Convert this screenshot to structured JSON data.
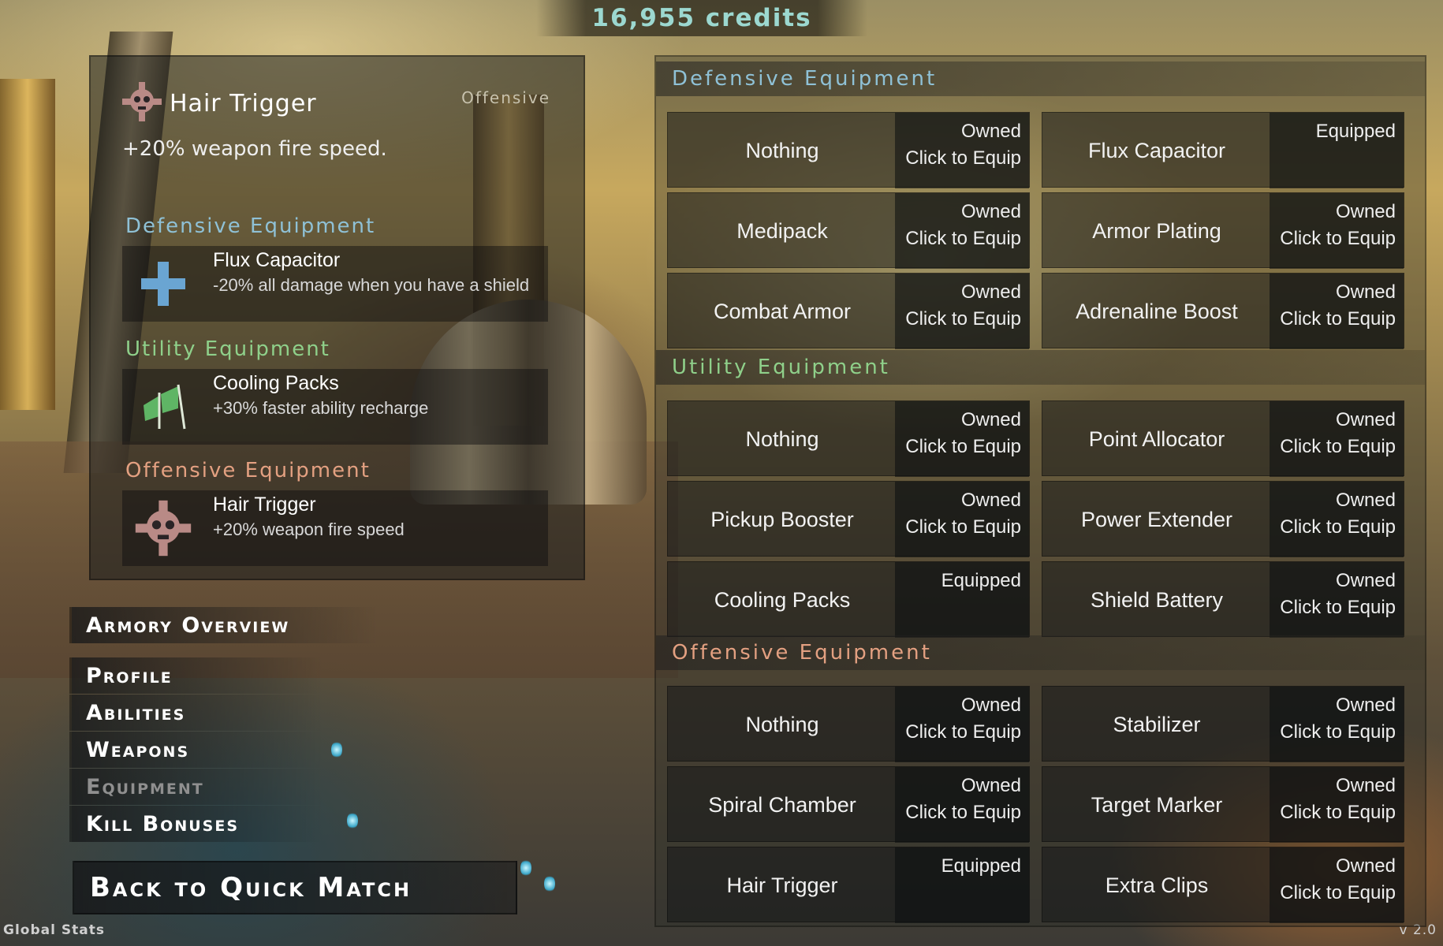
{
  "credits": "16,955 credits",
  "colors": {
    "defensive": "#8fc1d6",
    "utility": "#8fd08a",
    "offensive": "#e3a081",
    "credits": "#9cd8d0"
  },
  "selected": {
    "name": "Hair Trigger",
    "type": "Offensive",
    "description": "+20% weapon fire speed.",
    "icon": "skull-gear-icon"
  },
  "loadout": [
    {
      "category": "Defensive Equipment",
      "name": "Flux Capacitor",
      "description": "-20% all damage when you have a shield",
      "icon": "plus-cross-icon"
    },
    {
      "category": "Utility Equipment",
      "name": "Cooling Packs",
      "description": "+30% faster ability recharge",
      "icon": "flags-icon"
    },
    {
      "category": "Offensive Equipment",
      "name": "Hair Trigger",
      "description": "+20% weapon fire speed",
      "icon": "skull-gear-icon"
    }
  ],
  "nav": {
    "overview": "Armory Overview",
    "items": [
      "Profile",
      "Abilities",
      "Weapons",
      "Equipment",
      "Kill Bonuses"
    ],
    "active_index": 3,
    "back": "Back to Quick Match"
  },
  "footer": {
    "left": "Global Stats",
    "right": "v 2.0"
  },
  "equipment": [
    {
      "title": "Defensive Equipment",
      "items": [
        {
          "name": "Nothing",
          "status": "Owned",
          "action": "Click to Equip"
        },
        {
          "name": "Flux Capacitor",
          "status": "Equipped",
          "action": ""
        },
        {
          "name": "Medipack",
          "status": "Owned",
          "action": "Click to Equip"
        },
        {
          "name": "Armor Plating",
          "status": "Owned",
          "action": "Click to Equip"
        },
        {
          "name": "Combat Armor",
          "status": "Owned",
          "action": "Click to Equip"
        },
        {
          "name": "Adrenaline Boost",
          "status": "Owned",
          "action": "Click to Equip"
        }
      ]
    },
    {
      "title": "Utility Equipment",
      "items": [
        {
          "name": "Nothing",
          "status": "Owned",
          "action": "Click to Equip"
        },
        {
          "name": "Point Allocator",
          "status": "Owned",
          "action": "Click to Equip"
        },
        {
          "name": "Pickup Booster",
          "status": "Owned",
          "action": "Click to Equip"
        },
        {
          "name": "Power Extender",
          "status": "Owned",
          "action": "Click to Equip"
        },
        {
          "name": "Cooling Packs",
          "status": "Equipped",
          "action": ""
        },
        {
          "name": "Shield Battery",
          "status": "Owned",
          "action": "Click to Equip"
        }
      ]
    },
    {
      "title": "Offensive Equipment",
      "items": [
        {
          "name": "Nothing",
          "status": "Owned",
          "action": "Click to Equip"
        },
        {
          "name": "Stabilizer",
          "status": "Owned",
          "action": "Click to Equip"
        },
        {
          "name": "Spiral Chamber",
          "status": "Owned",
          "action": "Click to Equip"
        },
        {
          "name": "Target Marker",
          "status": "Owned",
          "action": "Click to Equip"
        },
        {
          "name": "Hair Trigger",
          "status": "Equipped",
          "action": ""
        },
        {
          "name": "Extra Clips",
          "status": "Owned",
          "action": "Click to Equip"
        }
      ]
    }
  ]
}
